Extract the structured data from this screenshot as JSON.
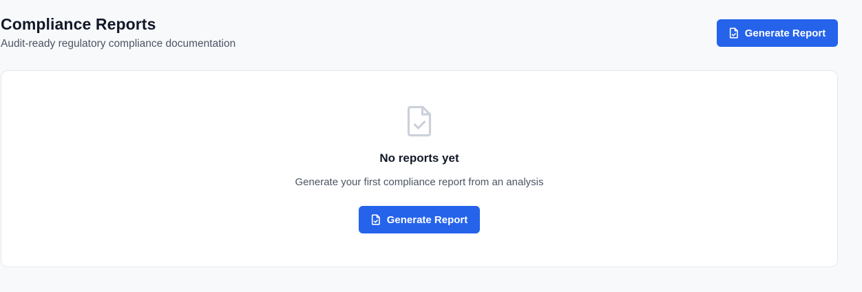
{
  "header": {
    "title": "Compliance Reports",
    "subtitle": "Audit-ready regulatory compliance documentation",
    "action_label": "Generate Report",
    "action_icon": "file-check-icon"
  },
  "empty_state": {
    "icon": "file-check-icon",
    "title": "No reports yet",
    "message": "Generate your first compliance report from an analysis",
    "action_label": "Generate Report",
    "action_icon": "file-check-icon"
  },
  "colors": {
    "accent": "#2563eb",
    "background": "#f8f9fb",
    "card": "#ffffff",
    "icon_muted": "#cbd1d9"
  }
}
